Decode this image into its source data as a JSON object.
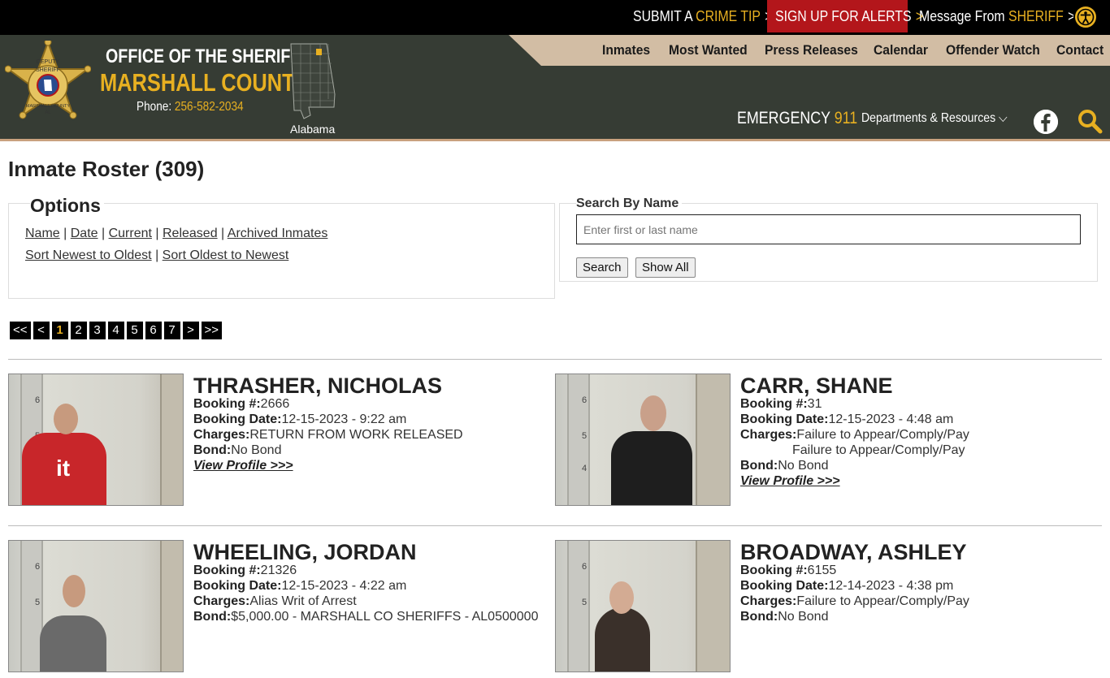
{
  "topbar": {
    "crime_tip": {
      "a": "SUBMIT A ",
      "b": "CRIME TIP"
    },
    "alerts": "SIGN UP FOR ALERTS",
    "message": {
      "a": "Message From ",
      "b": "SHERIFF"
    },
    "chevron": ">"
  },
  "header": {
    "office": "OFFICE OF THE SHERIFF",
    "county": "MARSHALL COUNTY",
    "phone_label": "Phone: ",
    "phone": "256-582-2034",
    "state": "Alabama",
    "badge_text": {
      "top": "DEPUTY",
      "mid": "SHERIFF",
      "bottom": "MARSHALL COUNTY",
      "al": "AL"
    },
    "emergency_label": "EMERGENCY ",
    "emergency_num": "911",
    "departments": "Departments & Resources"
  },
  "nav": [
    "Inmates",
    "Most Wanted",
    "Press Releases",
    "Calendar",
    "Offender Watch",
    "Contact"
  ],
  "page": {
    "title": "Inmate Roster (309)",
    "options_legend": "Options",
    "options_line1": [
      "Name",
      "Date",
      "Current",
      "Released",
      "Archived Inmates"
    ],
    "options_line2": [
      "Sort Newest to Oldest",
      "Sort Oldest to Newest"
    ],
    "separator": " | ",
    "search_legend": "Search By Name",
    "search_placeholder": "Enter first or last name",
    "search_button": "Search",
    "show_all_button": "Show All"
  },
  "pager": [
    "<<",
    "<",
    "1",
    "2",
    "3",
    "4",
    "5",
    "6",
    "7",
    ">",
    ">>"
  ],
  "pager_active": "1",
  "labels": {
    "booking_no": "Booking #:",
    "booking_date": "Booking Date:",
    "charges": "Charges:",
    "bond": "Bond:",
    "view_profile": "View Profile >>>"
  },
  "inmates": [
    {
      "name": "THRASHER, NICHOLAS",
      "booking": "2666",
      "date": "12-15-2023 - 9:22 am",
      "charges": [
        "RETURN FROM WORK RELEASED"
      ],
      "bond": "No Bond"
    },
    {
      "name": "CARR, SHANE",
      "booking": "31",
      "date": "12-15-2023 - 4:48 am",
      "charges": [
        "Failure to Appear/Comply/Pay",
        "Failure to Appear/Comply/Pay"
      ],
      "bond": "No Bond"
    },
    {
      "name": "WHEELING, JORDAN",
      "booking": "21326",
      "date": "12-15-2023 - 4:22 am",
      "charges": [
        "Alias Writ of Arrest"
      ],
      "bond": "$5,000.00 - MARSHALL CO SHERIFFS - AL0500000"
    },
    {
      "name": "BROADWAY, ASHLEY",
      "booking": "6155",
      "date": "12-14-2023 - 4:38 pm",
      "charges": [
        "Failure to Appear/Comply/Pay"
      ],
      "bond": "No Bond"
    }
  ],
  "photo_ruler": [
    "6",
    "5",
    "4"
  ],
  "colors": {
    "gold": "#e8b021",
    "header": "#363c34",
    "tan": "#d2bda4",
    "alert_red": "#b3161b"
  }
}
